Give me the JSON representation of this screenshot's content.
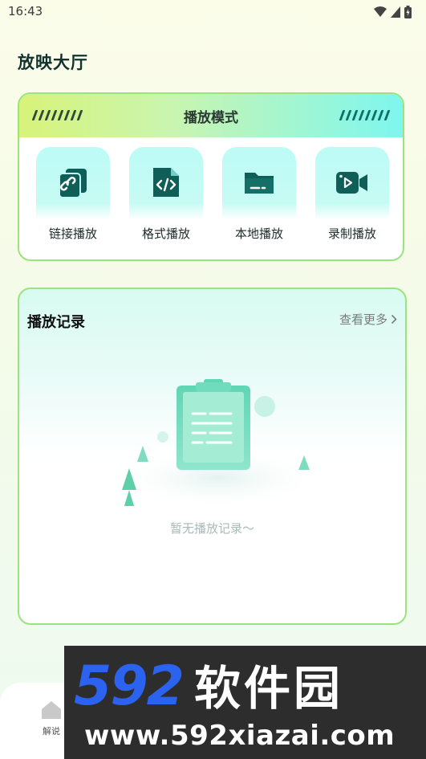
{
  "status_bar": {
    "time": "16:43"
  },
  "page": {
    "title": "放映大厅"
  },
  "play_mode": {
    "title": "播放模式",
    "items": [
      {
        "label": "链接播放",
        "icon": "link-icon"
      },
      {
        "label": "格式播放",
        "icon": "code-file-icon"
      },
      {
        "label": "本地播放",
        "icon": "folder-icon"
      },
      {
        "label": "录制播放",
        "icon": "video-camera-icon"
      }
    ]
  },
  "records": {
    "title": "播放记录",
    "more_label": "查看更多",
    "empty_text": "暂无播放记录～"
  },
  "bottom_nav": {
    "items": [
      {
        "label": "解说",
        "icon": "home-icon"
      }
    ]
  },
  "watermark": {
    "brand_number": "592",
    "brand_name": "软件园",
    "url": "www.592xiazai.com"
  },
  "colors": {
    "accent_green": "#9be37c",
    "icon_dark_teal": "#0f5e57",
    "icon_bg": "#bdfbf7",
    "watermark_blue": "#2b63f0"
  }
}
